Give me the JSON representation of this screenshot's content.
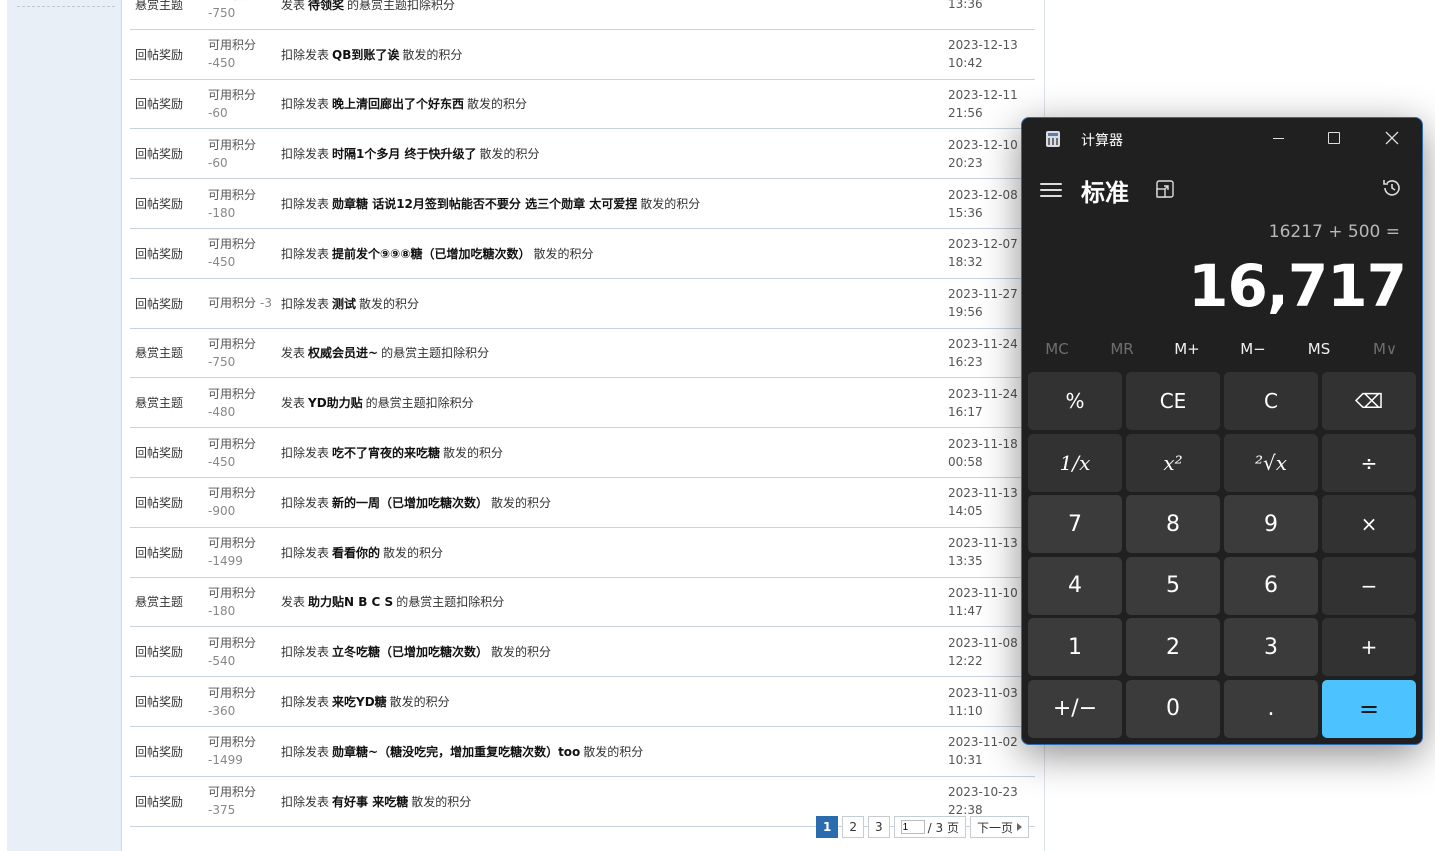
{
  "credit_log": {
    "rows": [
      {
        "type": "悬赏主题",
        "credit": "可用积分",
        "amount": "-750",
        "pre": "发表",
        "title": "待领奖",
        "post": "的悬赏主题扣除积分",
        "date": "",
        "time": "13:36",
        "inline": false
      },
      {
        "type": "回帖奖励",
        "credit": "可用积分",
        "amount": "-450",
        "pre": "扣除发表",
        "title": "QB到账了诶",
        "post": "散发的积分",
        "date": "2023-12-13",
        "time": "10:42",
        "inline": false
      },
      {
        "type": "回帖奖励",
        "credit": "可用积分",
        "amount": "-60",
        "pre": "扣除发表",
        "title": "晚上清回廊出了个好东西",
        "post": "散发的积分",
        "date": "2023-12-11",
        "time": "21:56",
        "inline": false
      },
      {
        "type": "回帖奖励",
        "credit": "可用积分",
        "amount": "-60",
        "pre": "扣除发表",
        "title": "时隔1个多月 终于快升级了",
        "post": "散发的积分",
        "date": "2023-12-10",
        "time": "20:23",
        "inline": false
      },
      {
        "type": "回帖奖励",
        "credit": "可用积分",
        "amount": "-180",
        "pre": "扣除发表",
        "title": "勋章糖 话说12月签到帖能否不要分 选三个勋章 太可爱捏",
        "post": "散发的积分",
        "date": "2023-12-08",
        "time": "15:36",
        "inline": false
      },
      {
        "type": "回帖奖励",
        "credit": "可用积分",
        "amount": "-450",
        "pre": "扣除发表",
        "title": "提前发个⑨⑨⑧糖（已增加吃糖次数）",
        "post": "散发的积分",
        "date": "2023-12-07",
        "time": "18:32",
        "inline": false
      },
      {
        "type": "回帖奖励",
        "credit": "可用积分",
        "amount": "-3",
        "pre": "扣除发表",
        "title": "测试",
        "post": "散发的积分",
        "date": "2023-11-27",
        "time": "19:56",
        "inline": true
      },
      {
        "type": "悬赏主题",
        "credit": "可用积分",
        "amount": "-750",
        "pre": "发表",
        "title": "权威会员进~",
        "post": "的悬赏主题扣除积分",
        "date": "2023-11-24",
        "time": "16:23",
        "inline": false
      },
      {
        "type": "悬赏主题",
        "credit": "可用积分",
        "amount": "-480",
        "pre": "发表",
        "title": "YD助力贴",
        "post": "的悬赏主题扣除积分",
        "date": "2023-11-24",
        "time": "16:17",
        "inline": false
      },
      {
        "type": "回帖奖励",
        "credit": "可用积分",
        "amount": "-450",
        "pre": "扣除发表",
        "title": "吃不了宵夜的来吃糖",
        "post": "散发的积分",
        "date": "2023-11-18",
        "time": "00:58",
        "inline": false
      },
      {
        "type": "回帖奖励",
        "credit": "可用积分",
        "amount": "-900",
        "pre": "扣除发表",
        "title": "新的一周（已增加吃糖次数）",
        "post": "散发的积分",
        "date": "2023-11-13",
        "time": "14:05",
        "inline": false
      },
      {
        "type": "回帖奖励",
        "credit": "可用积分",
        "amount": "-1499",
        "pre": "扣除发表",
        "title": "看看你的",
        "post": "散发的积分",
        "date": "2023-11-13",
        "time": "13:35",
        "inline": false
      },
      {
        "type": "悬赏主题",
        "credit": "可用积分",
        "amount": "-180",
        "pre": "发表",
        "title": "助力贴N B C S",
        "post": "的悬赏主题扣除积分",
        "date": "2023-11-10",
        "time": "11:47",
        "inline": false
      },
      {
        "type": "回帖奖励",
        "credit": "可用积分",
        "amount": "-540",
        "pre": "扣除发表",
        "title": "立冬吃糖（已增加吃糖次数）",
        "post": "散发的积分",
        "date": "2023-11-08",
        "time": "12:22",
        "inline": false
      },
      {
        "type": "回帖奖励",
        "credit": "可用积分",
        "amount": "-360",
        "pre": "扣除发表",
        "title": "来吃YD糖",
        "post": "散发的积分",
        "date": "2023-11-03",
        "time": "11:10",
        "inline": false
      },
      {
        "type": "回帖奖励",
        "credit": "可用积分",
        "amount": "-1499",
        "pre": "扣除发表",
        "title": "勋章糖~（糖没吃完，增加重复吃糖次数）too",
        "post": "散发的积分",
        "date": "2023-11-02",
        "time": "10:31",
        "inline": false
      },
      {
        "type": "回帖奖励",
        "credit": "可用积分",
        "amount": "-375",
        "pre": "扣除发表",
        "title": "有好事 来吃糖",
        "post": "散发的积分",
        "date": "2023-10-23",
        "time": "22:38",
        "inline": false
      }
    ]
  },
  "pager": {
    "pages": [
      "1",
      "2",
      "3"
    ],
    "current": "1",
    "jump_value": "1",
    "total_label": "/ 3 页",
    "next_label": "下一页"
  },
  "calculator": {
    "window_title": "计算器",
    "mode": "标准",
    "expression": "16217 + 500 =",
    "result": "16,717",
    "memory": [
      "MC",
      "MR",
      "M+",
      "M−",
      "MS",
      "M∨"
    ],
    "keys": [
      [
        "%",
        "CE",
        "C",
        "⌫"
      ],
      [
        "1/x",
        "x²",
        "²√x",
        "÷"
      ],
      [
        "7",
        "8",
        "9",
        "×"
      ],
      [
        "4",
        "5",
        "6",
        "−"
      ],
      [
        "1",
        "2",
        "3",
        "+"
      ],
      [
        "+/−",
        "0",
        ".",
        "="
      ]
    ]
  }
}
